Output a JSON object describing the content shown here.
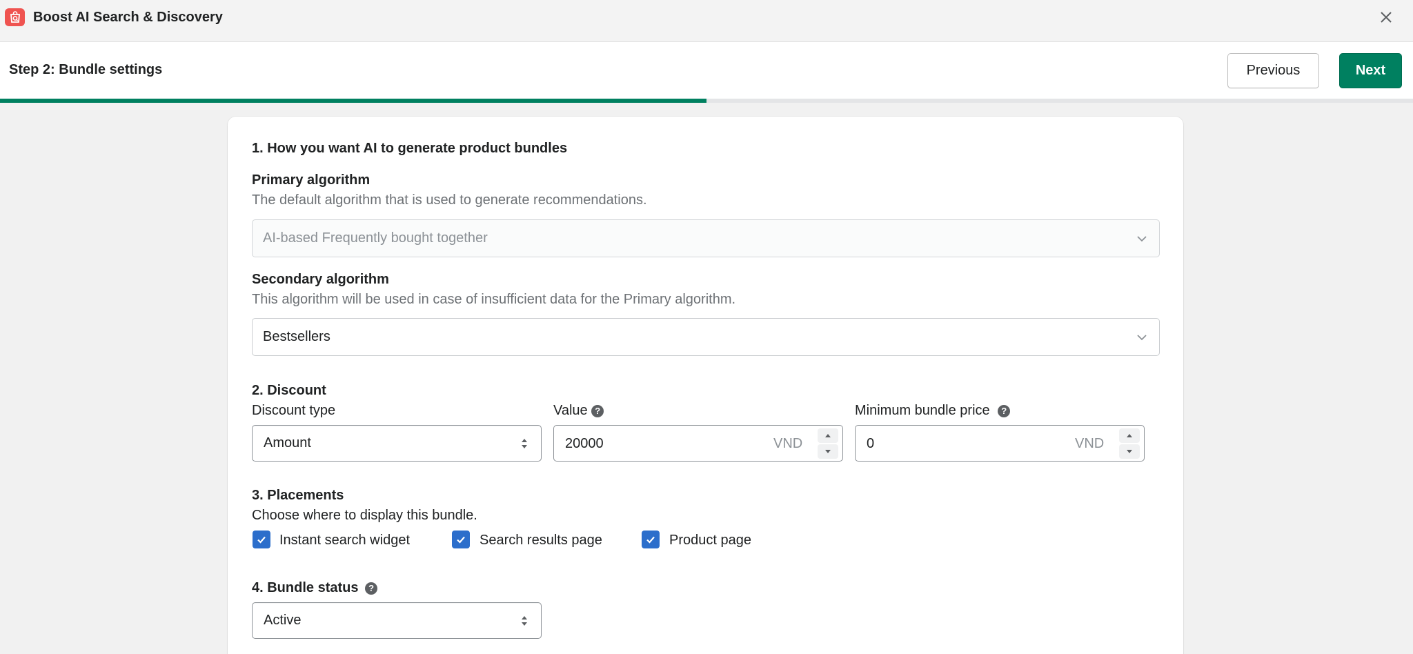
{
  "app": {
    "title": "Boost AI Search & Discovery",
    "logo_icon": "search-bag-icon",
    "brand_color": "#ef5350"
  },
  "step": {
    "title": "Step 2: Bundle settings",
    "previous_label": "Previous",
    "next_label": "Next",
    "progress_fraction": 0.5
  },
  "section1": {
    "heading": "1. How you want AI to generate product bundles",
    "primary": {
      "label": "Primary algorithm",
      "help": "The default algorithm that is used to generate recommendations.",
      "value": "AI-based Frequently bought together"
    },
    "secondary": {
      "label": "Secondary algorithm",
      "help": "This algorithm will be used in case of insufficient data for the Primary algorithm.",
      "value": "Bestsellers"
    }
  },
  "section2": {
    "heading": "2. Discount",
    "discount_type": {
      "label": "Discount type",
      "value": "Amount"
    },
    "value_field": {
      "label": "Value",
      "value": "20000",
      "suffix": "VND"
    },
    "min_price": {
      "label": "Minimum bundle price",
      "value": "0",
      "suffix": "VND"
    }
  },
  "section3": {
    "heading": "3. Placements",
    "help": "Choose where to display this bundle.",
    "options": [
      {
        "label": "Instant search widget",
        "checked": true
      },
      {
        "label": "Search results page",
        "checked": true
      },
      {
        "label": "Product page",
        "checked": true
      }
    ]
  },
  "section4": {
    "heading": "4. Bundle status",
    "value": "Active"
  },
  "colors": {
    "primary_green": "#008060",
    "checkbox_blue": "#2c6ecb"
  }
}
